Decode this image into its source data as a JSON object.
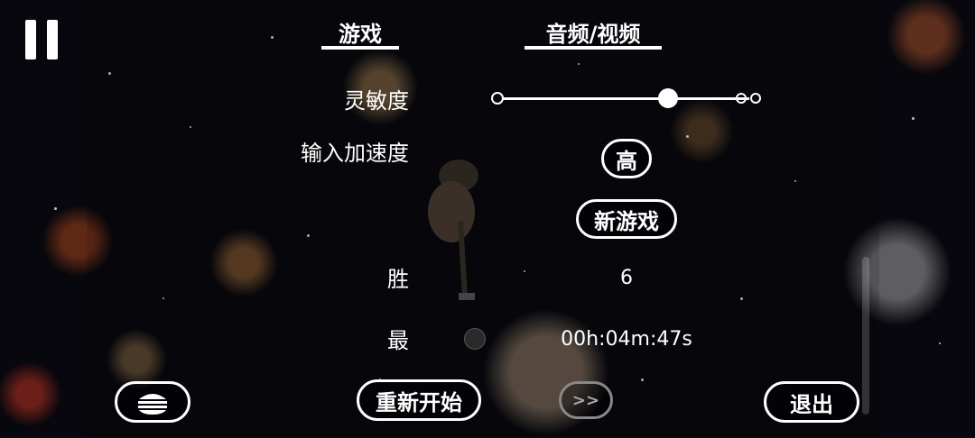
{
  "tabs": {
    "game": "游戏",
    "audio_video": "音频/视频"
  },
  "settings": {
    "sensitivity_label": "灵敏度",
    "sensitivity_fraction": 0.68,
    "accel_label": "输入加速度",
    "accel_value": "高",
    "new_game_label": "新游戏",
    "wins_label": "胜",
    "wins_value": "6",
    "best_label": "最",
    "best_value": "00h:04m:47s"
  },
  "bottom": {
    "restart_label": "重新开始",
    "skip_label": ">>",
    "quit_label": "退出"
  },
  "icons": {
    "pause": "pause-icon",
    "burger": "burger-icon",
    "infinity": "infinity-icon"
  }
}
